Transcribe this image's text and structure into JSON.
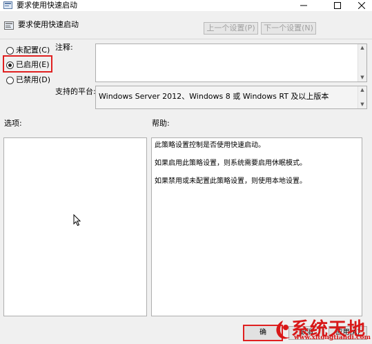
{
  "window": {
    "title": "要求使用快速启动"
  },
  "header": {
    "policy_title": "要求使用快速启动",
    "prev_button": "上一个设置(P)",
    "next_button": "下一个设置(N)"
  },
  "radios": [
    {
      "label": "未配置(C)",
      "selected": false
    },
    {
      "label": "已启用(E)",
      "selected": true
    },
    {
      "label": "已禁用(D)",
      "selected": false
    }
  ],
  "comment": {
    "label": "注释:",
    "value": ""
  },
  "platform": {
    "label": "支持的平台:",
    "value": "Windows Server 2012、Windows 8 或 Windows RT 及以上版本"
  },
  "options": {
    "label": "选项:"
  },
  "help": {
    "label": "帮助:",
    "lines": [
      "此策略设置控制是否使用快速启动。",
      "如果启用此策略设置，则系统需要启用休眠模式。",
      "如果禁用或未配置此策略设置，则使用本地设置。"
    ]
  },
  "footer": {
    "ok_button": "确",
    "cancel_button": "取消",
    "apply_button": "应用(A)"
  },
  "watermark": {
    "text": "系统天地",
    "url": "www.xitongtiandi.com"
  },
  "icons": {
    "app": "policy-icon",
    "minimize": "minimize-icon",
    "maximize": "maximize-icon",
    "close": "close-icon"
  },
  "colors": {
    "highlight": "#e02020",
    "watermark": "#d81818"
  }
}
